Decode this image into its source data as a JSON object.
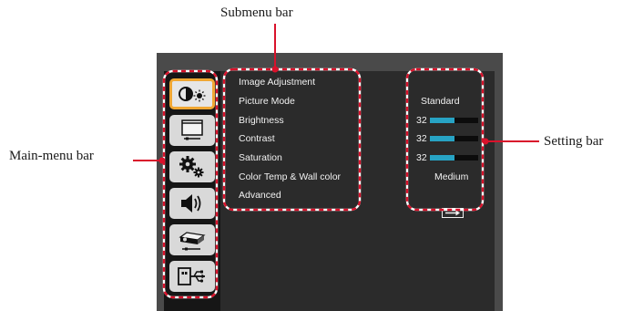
{
  "callouts": {
    "submenu": "Submenu bar",
    "mainmenu": "Main-menu bar",
    "setting": "Setting bar"
  },
  "main_menu": {
    "items": [
      {
        "icon": "contrast-brightness-icon",
        "active": true
      },
      {
        "icon": "screen-display-icon",
        "active": false
      },
      {
        "icon": "gears-settings-icon",
        "active": false
      },
      {
        "icon": "speaker-volume-icon",
        "active": false
      },
      {
        "icon": "projector-icon",
        "active": false
      },
      {
        "icon": "usb-icon",
        "active": false
      }
    ]
  },
  "submenu": {
    "items": [
      {
        "label": "Image Adjustment"
      },
      {
        "label": "Picture Mode"
      },
      {
        "label": "Brightness"
      },
      {
        "label": "Contrast"
      },
      {
        "label": "Saturation"
      },
      {
        "label": "Color Temp & Wall color"
      },
      {
        "label": "Advanced"
      }
    ]
  },
  "settings": {
    "picture_mode": "Standard",
    "brightness": {
      "value": "32",
      "level": 0.5
    },
    "contrast": {
      "value": "32",
      "level": 0.5
    },
    "saturation": {
      "value": "32",
      "level": 0.5
    },
    "color_temp": "Medium",
    "advanced_icon": "enter-arrow-icon"
  },
  "colors": {
    "highlight_dash": "#d9122b",
    "slider_fill": "#27a3c4",
    "active_tile_border": "#f0a733"
  }
}
